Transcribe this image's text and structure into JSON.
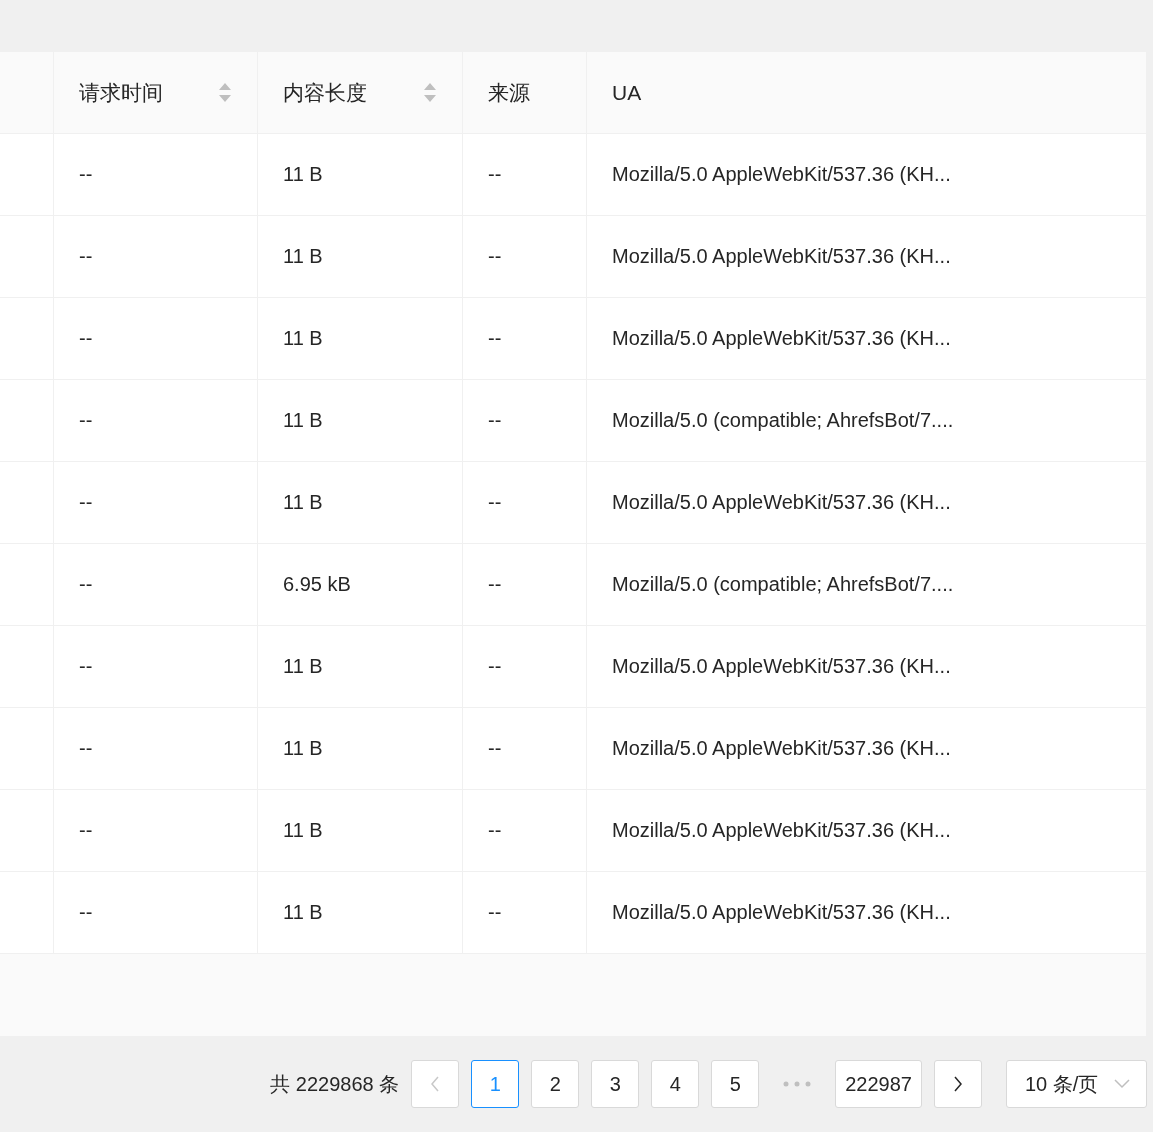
{
  "table": {
    "columns": [
      {
        "label": "请求时间",
        "sortable": true
      },
      {
        "label": "内容长度",
        "sortable": true
      },
      {
        "label": "来源",
        "sortable": false
      },
      {
        "label": "UA",
        "sortable": false
      }
    ],
    "rows": [
      [
        "--",
        "11 B",
        "--",
        "Mozilla/5.0 AppleWebKit/537.36 (KH..."
      ],
      [
        "--",
        "11 B",
        "--",
        "Mozilla/5.0 AppleWebKit/537.36 (KH..."
      ],
      [
        "--",
        "11 B",
        "--",
        "Mozilla/5.0 AppleWebKit/537.36 (KH..."
      ],
      [
        "--",
        "11 B",
        "--",
        "Mozilla/5.0 (compatible; AhrefsBot/7...."
      ],
      [
        "--",
        "11 B",
        "--",
        "Mozilla/5.0 AppleWebKit/537.36 (KH..."
      ],
      [
        "--",
        "6.95 kB",
        "--",
        "Mozilla/5.0 (compatible; AhrefsBot/7...."
      ],
      [
        "--",
        "11 B",
        "--",
        "Mozilla/5.0 AppleWebKit/537.36 (KH..."
      ],
      [
        "--",
        "11 B",
        "--",
        "Mozilla/5.0 AppleWebKit/537.36 (KH..."
      ],
      [
        "--",
        "11 B",
        "--",
        "Mozilla/5.0 AppleWebKit/537.36 (KH..."
      ],
      [
        "--",
        "11 B",
        "--",
        "Mozilla/5.0 AppleWebKit/537.36 (KH..."
      ]
    ]
  },
  "pagination": {
    "total": "共 2229868 条",
    "items": [
      {
        "kind": "prev",
        "disabled": true
      },
      {
        "kind": "page",
        "label": "1",
        "selected": true
      },
      {
        "kind": "page",
        "label": "2",
        "selected": false
      },
      {
        "kind": "page",
        "label": "3",
        "selected": false
      },
      {
        "kind": "page",
        "label": "4",
        "selected": false
      },
      {
        "kind": "page",
        "label": "5",
        "selected": false
      },
      {
        "kind": "ellipsis"
      },
      {
        "kind": "page",
        "label": "222987",
        "selected": false
      },
      {
        "kind": "next",
        "disabled": false
      }
    ],
    "page_size": "10 条/页"
  }
}
